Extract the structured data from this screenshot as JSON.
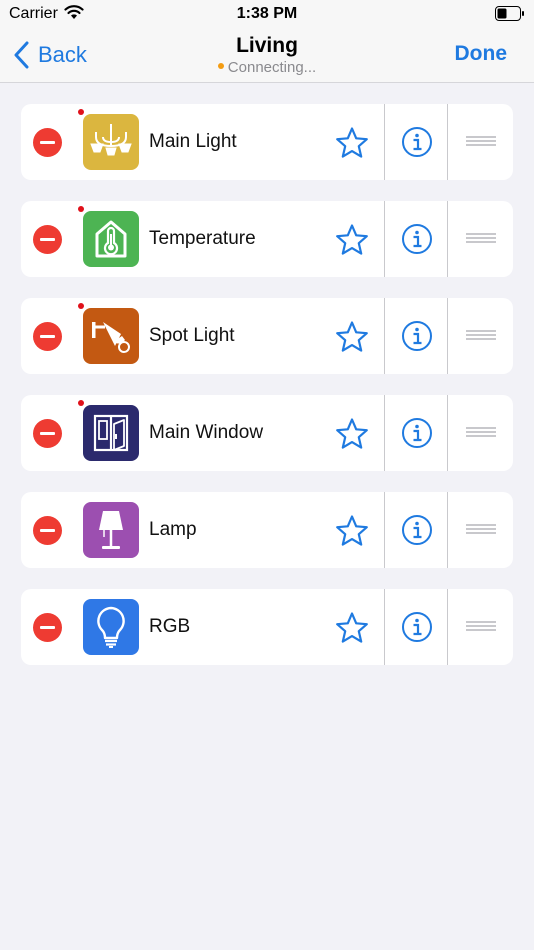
{
  "status_bar": {
    "carrier": "Carrier",
    "time": "1:38 PM"
  },
  "nav": {
    "back_label": "Back",
    "title": "Living",
    "subtitle": "Connecting...",
    "done_label": "Done"
  },
  "colors": {
    "accent": "#1f7ae0",
    "delete": "#ee3b32",
    "connecting_dot": "#f39c12",
    "unread_dot": "#e0101a"
  },
  "devices": [
    {
      "name": "Main Light",
      "icon": "chandelier-icon",
      "icon_bg": "#dbb63f",
      "unread": true
    },
    {
      "name": "Temperature",
      "icon": "thermometer-house-icon",
      "icon_bg": "#4db453",
      "unread": true
    },
    {
      "name": "Spot Light",
      "icon": "spot-light-icon",
      "icon_bg": "#c35912",
      "unread": true
    },
    {
      "name": "Main Window",
      "icon": "window-icon",
      "icon_bg": "#2b2a6d",
      "unread": true
    },
    {
      "name": "Lamp",
      "icon": "lamp-icon",
      "icon_bg": "#9c4fb0",
      "unread": false
    },
    {
      "name": "RGB",
      "icon": "light-bulb-icon",
      "icon_bg": "#2f78e6",
      "unread": false
    }
  ]
}
